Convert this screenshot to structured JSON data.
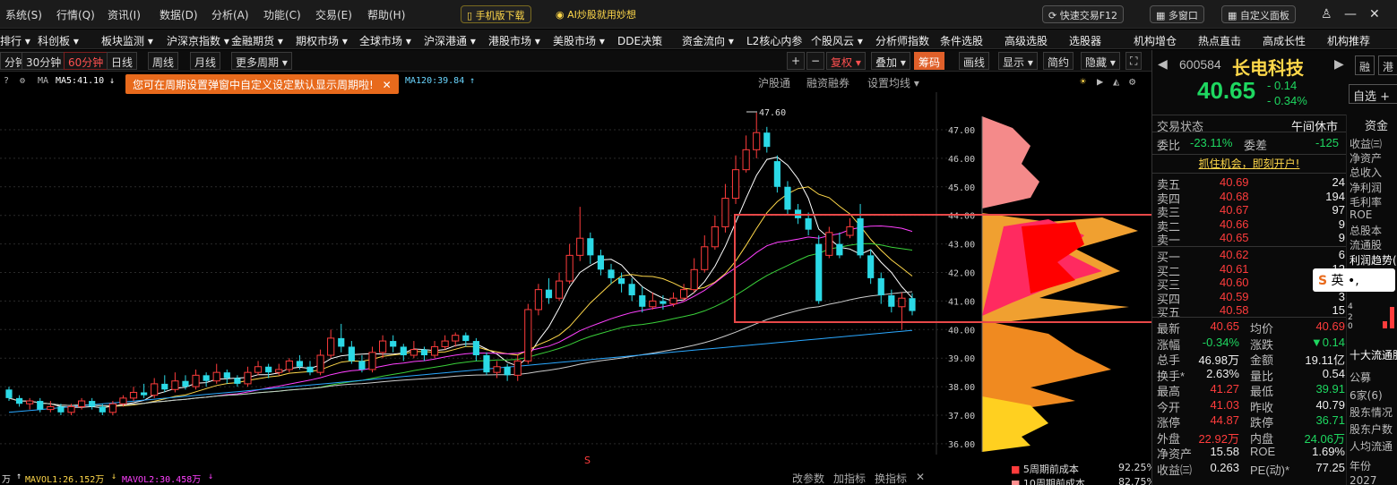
{
  "menu": {
    "items": [
      "系统(S)",
      "行情(Q)",
      "资讯(I)",
      "数据(D)",
      "分析(A)",
      "功能(C)",
      "交易(E)",
      "帮助(H)"
    ],
    "mobile_download": "手机版下载",
    "ai_label": "AI炒股就用妙想",
    "quick_trade": "快速交易F12",
    "multi_window": "多窗口",
    "custom_panel": "自定义面板"
  },
  "nav": {
    "items": [
      "排行 ▾",
      "科创板 ▾",
      "板块监测 ▾",
      "沪深京指数 ▾",
      "金融期货 ▾",
      "期权市场 ▾",
      "全球市场 ▾",
      "沪深港通 ▾",
      "港股市场 ▾",
      "美股市场 ▾",
      "DDE决策",
      "资金流向 ▾",
      "L2核心内参",
      "个股风云 ▾",
      "分析师指数",
      "条件选股",
      "高级选股",
      "选股器",
      "机构增仓",
      "热点直击",
      "高成长性",
      "机构推荐"
    ]
  },
  "periods": {
    "items": [
      "分钟",
      "30分钟",
      "60分钟",
      "日线",
      "周线",
      "月线",
      "更多周期 ▾"
    ],
    "active_index": 2
  },
  "chart_toolbar": {
    "items": [
      "+",
      "−",
      "复权 ▾",
      "叠加 ▾",
      "筹码",
      "画线",
      "显示 ▾",
      "简约",
      "隐藏 ▾"
    ]
  },
  "ma_header": {
    "ma_label": "MA",
    "ma5": "MA5:41.10",
    "ma120": "MA120:39.84"
  },
  "tip_text": "您可在周期设置弹窗中自定义设定默认显示周期啦!",
  "sub_header": [
    "沪股通",
    "融资融券",
    "设置均线 ▾"
  ],
  "price_axis": [
    "47.00",
    "46.00",
    "45.00",
    "44.00",
    "43.00",
    "42.00",
    "41.00",
    "40.00",
    "39.00",
    "38.00",
    "37.00",
    "36.00"
  ],
  "peak_label": "47.60",
  "bottom": {
    "vol_label": "万",
    "mavol1": "MAVOL1:26.152万",
    "mavol2": "MAVOL2:30.458万",
    "tools": [
      "改参数",
      "加指标",
      "换指标"
    ]
  },
  "chips_legend": [
    {
      "label": "5周期前成本",
      "value": "92.25%",
      "color": "#ff3c3c"
    },
    {
      "label": "10周期前成本",
      "value": "82.75%",
      "color": "#ff9090"
    }
  ],
  "stock": {
    "code": "600584",
    "name": "长电科技",
    "price": "40.65",
    "change": "- 0.14",
    "change_pct": "- 0.34%",
    "btn_margin": "融",
    "btn_hk": "港",
    "btn_watch": "自选"
  },
  "quote": {
    "status_label": "交易状态",
    "status_value": "午间休市",
    "weibi_label": "委比",
    "weibi_value": "-23.11%",
    "weicha_label": "委差",
    "weicha_value": "-125",
    "open_account": "抓住机会，即刻开户!",
    "asks": [
      {
        "label": "卖五",
        "price": "40.69",
        "vol": "24"
      },
      {
        "label": "卖四",
        "price": "40.68",
        "vol": "194"
      },
      {
        "label": "卖三",
        "price": "40.67",
        "vol": "97"
      },
      {
        "label": "卖二",
        "price": "40.66",
        "vol": "9"
      },
      {
        "label": "卖一",
        "price": "40.65",
        "vol": "9"
      }
    ],
    "bids": [
      {
        "label": "买一",
        "price": "40.62",
        "vol": "6"
      },
      {
        "label": "买二",
        "price": "40.61",
        "vol": "12"
      },
      {
        "label": "买三",
        "price": "40.60",
        "vol": "172"
      },
      {
        "label": "买四",
        "price": "40.59",
        "vol": "3"
      },
      {
        "label": "买五",
        "price": "40.58",
        "vol": "15"
      }
    ],
    "stats": [
      [
        "最新",
        "40.65",
        "均价",
        "40.69"
      ],
      [
        "涨幅",
        "-0.34%",
        "涨跌",
        "▼0.14"
      ],
      [
        "总手",
        "46.98万",
        "金额",
        "19.11亿"
      ],
      [
        "换手*",
        "2.63%",
        "量比",
        "0.54"
      ],
      [
        "最高",
        "41.27",
        "最低",
        "39.91"
      ],
      [
        "今开",
        "41.03",
        "昨收",
        "40.79"
      ],
      [
        "涨停",
        "44.87",
        "跌停",
        "36.71"
      ],
      [
        "外盘",
        "22.92万",
        "内盘",
        "24.06万"
      ],
      [
        "净资产",
        "15.58",
        "ROE",
        "1.69%"
      ],
      [
        "收益㈢",
        "0.263",
        "PE(动)*",
        "77.25"
      ]
    ]
  },
  "edge_panel": {
    "tab": "资金",
    "items": [
      "收益㈢",
      "净资产",
      "总收入",
      "净利润",
      "毛利率",
      "ROE",
      "总股本",
      "流通股",
      "利润趋势("
    ],
    "lower": [
      "十大流通股",
      "公募",
      "6家(6)",
      "股东情况",
      "股东户数",
      "人均流通",
      "年份",
      "2027"
    ]
  },
  "chart_data": {
    "type": "candlestick",
    "ylim": [
      36.0,
      47.6
    ],
    "y_ticks": [
      36,
      37,
      38,
      39,
      40,
      41,
      42,
      43,
      44,
      45,
      46,
      47
    ],
    "candles": [
      [
        37.9,
        37.6,
        38.0,
        37.5
      ],
      [
        37.6,
        37.4,
        37.7,
        37.3
      ],
      [
        37.4,
        37.5,
        37.6,
        37.2
      ],
      [
        37.5,
        37.2,
        37.6,
        37.1
      ],
      [
        37.2,
        37.3,
        37.5,
        37.1
      ],
      [
        37.3,
        37.1,
        37.4,
        37.0
      ],
      [
        37.1,
        37.3,
        37.4,
        37.0
      ],
      [
        37.3,
        37.5,
        37.6,
        37.2
      ],
      [
        37.5,
        37.3,
        37.6,
        37.2
      ],
      [
        37.3,
        37.1,
        37.4,
        37.0
      ],
      [
        37.1,
        37.4,
        37.5,
        37.0
      ],
      [
        37.4,
        37.6,
        37.7,
        37.3
      ],
      [
        37.6,
        37.8,
        38.0,
        37.5
      ],
      [
        37.8,
        37.7,
        38.1,
        37.6
      ],
      [
        37.7,
        38.1,
        38.3,
        37.6
      ],
      [
        38.1,
        37.9,
        38.4,
        37.8
      ],
      [
        37.9,
        38.2,
        38.5,
        37.8
      ],
      [
        38.2,
        38.0,
        38.4,
        37.9
      ],
      [
        38.0,
        38.4,
        38.6,
        37.9
      ],
      [
        38.4,
        38.2,
        38.5,
        38.0
      ],
      [
        38.2,
        38.5,
        38.8,
        38.1
      ],
      [
        38.5,
        38.3,
        38.6,
        38.1
      ],
      [
        38.3,
        38.1,
        38.4,
        38.0
      ],
      [
        38.1,
        38.5,
        38.7,
        38.0
      ],
      [
        38.5,
        38.7,
        38.9,
        38.4
      ],
      [
        38.7,
        38.5,
        38.8,
        38.3
      ],
      [
        38.5,
        38.6,
        38.8,
        38.4
      ],
      [
        38.6,
        38.9,
        39.0,
        38.5
      ],
      [
        38.9,
        38.7,
        39.1,
        38.6
      ],
      [
        38.7,
        38.5,
        38.9,
        38.4
      ],
      [
        38.5,
        39.1,
        39.3,
        38.4
      ],
      [
        39.1,
        39.7,
        40.0,
        39.0
      ],
      [
        39.7,
        39.4,
        40.2,
        39.2
      ],
      [
        39.4,
        38.9,
        39.6,
        38.8
      ],
      [
        38.9,
        38.6,
        39.1,
        38.5
      ],
      [
        38.6,
        39.2,
        39.4,
        38.5
      ],
      [
        39.2,
        39.6,
        39.8,
        39.0
      ],
      [
        39.6,
        39.4,
        39.8,
        39.2
      ],
      [
        39.4,
        39.1,
        39.5,
        38.9
      ],
      [
        39.1,
        39.3,
        39.6,
        39.0
      ],
      [
        39.3,
        39.1,
        39.4,
        38.9
      ],
      [
        39.1,
        39.4,
        39.6,
        39.0
      ],
      [
        39.4,
        39.6,
        39.8,
        39.3
      ],
      [
        39.6,
        39.8,
        39.9,
        39.4
      ],
      [
        39.8,
        39.6,
        39.9,
        39.4
      ],
      [
        39.6,
        39.1,
        39.7,
        38.9
      ],
      [
        39.1,
        38.5,
        39.2,
        38.4
      ],
      [
        38.5,
        38.7,
        38.9,
        38.3
      ],
      [
        38.7,
        38.4,
        38.8,
        38.2
      ],
      [
        38.4,
        38.9,
        39.1,
        38.2
      ],
      [
        38.9,
        40.7,
        40.9,
        38.8
      ],
      [
        40.7,
        41.4,
        41.6,
        40.5
      ],
      [
        41.4,
        41.1,
        41.8,
        40.9
      ],
      [
        41.1,
        41.7,
        42.0,
        41.0
      ],
      [
        41.7,
        42.6,
        43.0,
        41.6
      ],
      [
        42.6,
        43.2,
        44.3,
        42.4
      ],
      [
        43.2,
        42.6,
        43.4,
        42.3
      ],
      [
        42.6,
        42.1,
        42.8,
        41.9
      ],
      [
        42.1,
        41.8,
        42.3,
        41.6
      ],
      [
        41.8,
        41.6,
        42.0,
        41.3
      ],
      [
        41.6,
        41.2,
        41.8,
        41.0
      ],
      [
        41.2,
        40.8,
        41.5,
        40.6
      ],
      [
        40.8,
        41.0,
        41.3,
        40.7
      ],
      [
        41.0,
        40.9,
        41.2,
        40.7
      ],
      [
        40.9,
        41.1,
        41.3,
        40.8
      ],
      [
        41.1,
        41.4,
        41.6,
        41.0
      ],
      [
        41.4,
        42.1,
        42.5,
        41.3
      ],
      [
        42.1,
        42.9,
        43.3,
        42.0
      ],
      [
        42.9,
        43.6,
        44.0,
        42.8
      ],
      [
        43.6,
        44.6,
        45.1,
        43.4
      ],
      [
        44.6,
        45.6,
        46.1,
        44.4
      ],
      [
        45.6,
        46.3,
        46.8,
        45.5
      ],
      [
        46.3,
        46.9,
        47.6,
        46.0
      ],
      [
        46.9,
        46.4,
        47.1,
        46.2
      ],
      [
        45.9,
        45.0,
        46.1,
        44.8
      ],
      [
        45.0,
        44.2,
        45.2,
        44.0
      ],
      [
        44.2,
        43.9,
        44.4,
        43.7
      ],
      [
        43.9,
        43.5,
        44.1,
        43.3
      ],
      [
        43.0,
        41.0,
        43.3,
        40.9
      ],
      [
        42.6,
        43.4,
        43.6,
        42.5
      ],
      [
        43.0,
        42.6,
        43.4,
        42.5
      ],
      [
        43.3,
        43.6,
        43.9,
        43.2
      ],
      [
        43.9,
        42.6,
        44.4,
        42.5
      ],
      [
        42.6,
        41.8,
        42.8,
        41.6
      ],
      [
        41.8,
        41.2,
        42.0,
        40.9
      ],
      [
        41.2,
        40.8,
        41.4,
        40.6
      ],
      [
        40.8,
        41.1,
        41.3,
        40.0
      ],
      [
        41.1,
        40.65,
        41.27,
        40.5
      ]
    ]
  }
}
